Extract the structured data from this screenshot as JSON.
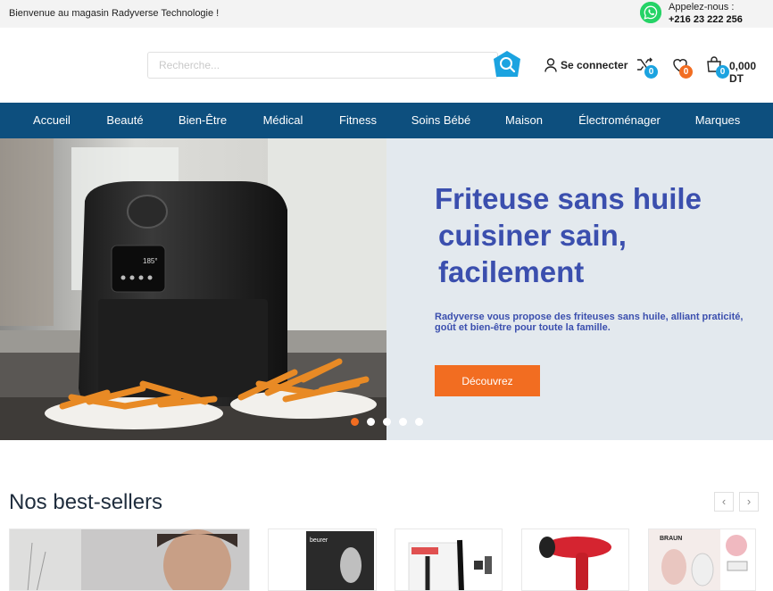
{
  "topbar": {
    "welcome": "Bienvenue au magasin Radyverse Technologie !",
    "call_label": "Appelez-nous :",
    "phone": "+216 23 222 256",
    "whatsapp_icon": "whatsapp-icon"
  },
  "header": {
    "search_placeholder": "Recherche...",
    "login_label": "Se connecter",
    "compare_count": "0",
    "wishlist_count": "0",
    "cart_count": "0",
    "cart_total": "0,000 DT"
  },
  "nav": {
    "items": [
      {
        "label": "Accueil"
      },
      {
        "label": "Beauté"
      },
      {
        "label": "Bien-Être"
      },
      {
        "label": "Médical"
      },
      {
        "label": "Fitness"
      },
      {
        "label": "Soins Bébé"
      },
      {
        "label": "Maison"
      },
      {
        "label": "Électroménager"
      },
      {
        "label": "Marques"
      }
    ]
  },
  "hero": {
    "title_line1": "Friteuse sans huile",
    "title_line2": "cuisiner sain,",
    "title_line3": "facilement",
    "description": "Radyverse vous propose des friteuses sans huile, alliant praticité, goût et bien-être pour toute la famille.",
    "cta": "Découvrez",
    "device_display": "185°",
    "slides_count": 5,
    "active_slide": 1
  },
  "bestsellers": {
    "title": "Nos best-sellers",
    "prev_icon": "chevron-left-icon",
    "next_icon": "chevron-right-icon",
    "product_brand_1": "beurer",
    "product_brand_2": "BRAUN"
  },
  "colors": {
    "nav_bg": "#0d4f7e",
    "accent_orange": "#f26d21",
    "hero_text": "#3b4fae",
    "badge_blue": "#1ba3e0",
    "search_btn": "#1ba3e0"
  }
}
